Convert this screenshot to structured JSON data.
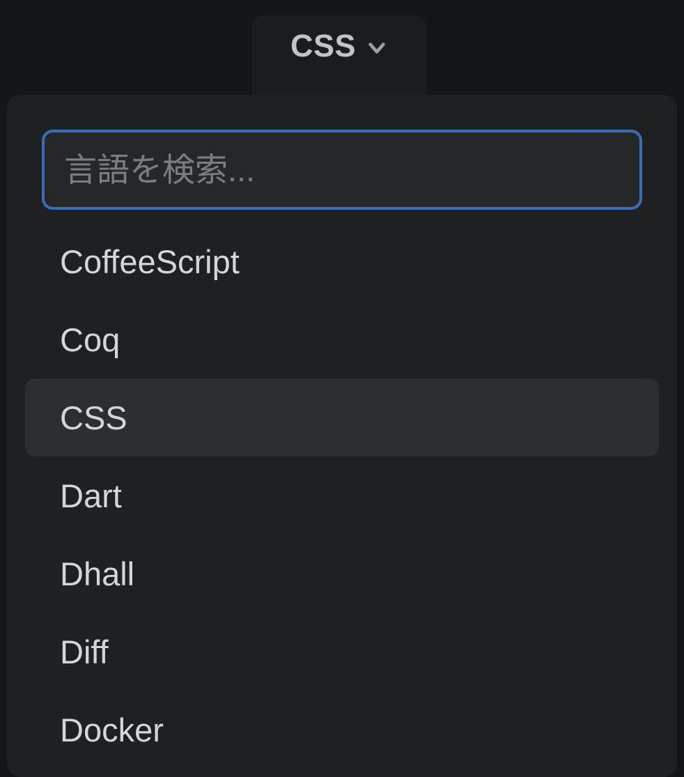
{
  "trigger": {
    "selected_label": "CSS"
  },
  "search": {
    "placeholder": "言語を検索..."
  },
  "options": [
    {
      "label": "CoffeeScript",
      "selected": false
    },
    {
      "label": "Coq",
      "selected": false
    },
    {
      "label": "CSS",
      "selected": true
    },
    {
      "label": "Dart",
      "selected": false
    },
    {
      "label": "Dhall",
      "selected": false
    },
    {
      "label": "Diff",
      "selected": false
    },
    {
      "label": "Docker",
      "selected": false
    }
  ]
}
